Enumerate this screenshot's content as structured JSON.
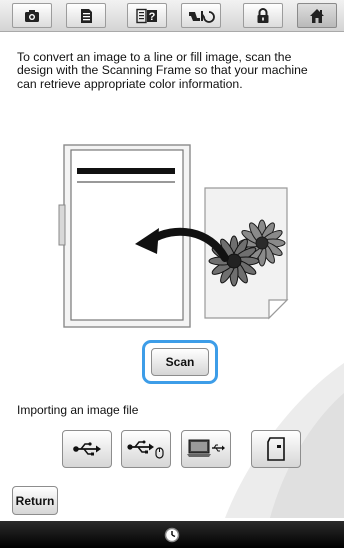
{
  "toolbar": {
    "buttons": [
      {
        "icon": "camera-icon"
      },
      {
        "icon": "document-icon"
      },
      {
        "icon": "help-icon"
      },
      {
        "icon": "thread-settings-icon"
      },
      {
        "icon": "lock-icon"
      },
      {
        "icon": "home-icon"
      }
    ],
    "help_glyph": "?"
  },
  "instruction": "To convert an image to a line or fill image, scan the design with the Scanning Frame so that your machine can retrieve appropriate color information.",
  "scan_button": {
    "label": "Scan"
  },
  "import": {
    "label": "Importing an image file",
    "buttons": [
      {
        "icon": "usb-icon"
      },
      {
        "icon": "usb-mouse-icon"
      },
      {
        "icon": "computer-usb-icon"
      },
      {
        "icon": "sd-card-icon"
      }
    ]
  },
  "return_button": {
    "label": "Return"
  },
  "bottom_bar": {
    "icon": "clock-icon"
  },
  "colors": {
    "focus_ring": "#3d9de8",
    "bottom_bar": "#000000"
  }
}
